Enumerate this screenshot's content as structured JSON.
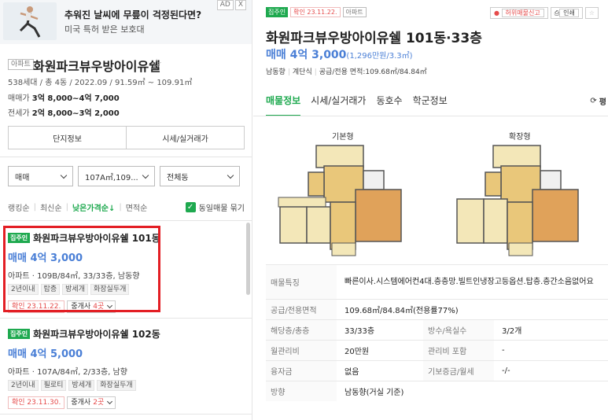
{
  "ad": {
    "title": "추워진 날씨에 무릎이 걱정된다면?",
    "subtitle": "미국 특허 받은 보호대",
    "ad_label": "AD",
    "close_label": "X"
  },
  "complex": {
    "type_tag": "아파트",
    "name": "화원파크뷰우방아이유쉘",
    "info": "538세대 / 총 4동 / 2022.09 / 91.59㎡ ~ 109.91㎡",
    "sale_label": "매매가",
    "sale_range": "3억 8,000~4억 7,000",
    "rent_label": "전세가",
    "rent_range": "2억 8,000~3억 2,000",
    "btn_info": "단지정보",
    "btn_price": "시세/실거래가"
  },
  "filters": {
    "trade": "매매",
    "area": "107A㎡,109...",
    "dong": "전체동"
  },
  "sort": {
    "items": [
      "랭킹순",
      "최신순",
      "낮은가격순↓",
      "면적순"
    ],
    "same_toggle": "동일매물 묶기",
    "check": "✓"
  },
  "listings": [
    {
      "badge": "집주인",
      "title": "화원파크뷰우방아이유쉘 101동",
      "price": "매매 4억 3,000",
      "detail": "아파트 · 109B/84㎡, 33/33층, 남동향",
      "tags": [
        "2년이내",
        "탑층",
        "방세개",
        "화장실두개"
      ],
      "confirm": "확인 23.11.22.",
      "agent_prefix": "중개사 ",
      "agent_count": "4곳"
    },
    {
      "badge": "집주인",
      "title": "화원파크뷰우방아이유쉘 102동",
      "price": "매매 4억 5,000",
      "detail": "아파트 · 107A/84㎡, 2/33층, 남향",
      "tags": [
        "2년이내",
        "필로티",
        "방세개",
        "화장실두개"
      ],
      "confirm": "확인 23.11.30.",
      "agent_prefix": "중개사 ",
      "agent_count": "2곳"
    }
  ],
  "detail": {
    "badge": "집주인",
    "confirm": "확인 23.11.22.",
    "type": "아파트",
    "report": "허위매물신고",
    "print": "인쇄",
    "star": "☆",
    "title": "화원파크뷰우방아이유쉘 101동·33층",
    "price": "매매 4억 3,000",
    "price_per": "(1,296만원/3.3㎡)",
    "sub": [
      "남동향",
      "계단식",
      "공급/전용 면적:109.68㎡/84.84㎡"
    ],
    "tabs": [
      "매물정보",
      "시세/실거래가",
      "동호수",
      "학군정보"
    ],
    "refresh": "평",
    "plan_basic": "기본형",
    "plan_ext": "확장형",
    "features_label": "매물특징",
    "features": "빠른이사.시스템에어컨4대.층층망.빌트인냉장고등옵션.탑층.층간소음없어요",
    "area_label": "공급/전용면적",
    "area": "109.68㎡/84.84㎡(전용률77%)",
    "floor_label": "해당층/총층",
    "floor": "33/33층",
    "rooms_label": "방수/욕실수",
    "rooms": "3/2개",
    "mgmt_label": "월관리비",
    "mgmt": "20만원",
    "mgmt_inc_label": "관리비 포함",
    "mgmt_inc": "-",
    "loan_label": "융자금",
    "loan": "없음",
    "deposit_label": "기보증금/월세",
    "deposit": "-/-",
    "dir_label": "방향",
    "dir": "남동향(거실 기준)"
  },
  "colors": {
    "accent_green": "#1ea94f",
    "price_blue": "#4a7fd6",
    "highlight_red": "#e31e24"
  }
}
